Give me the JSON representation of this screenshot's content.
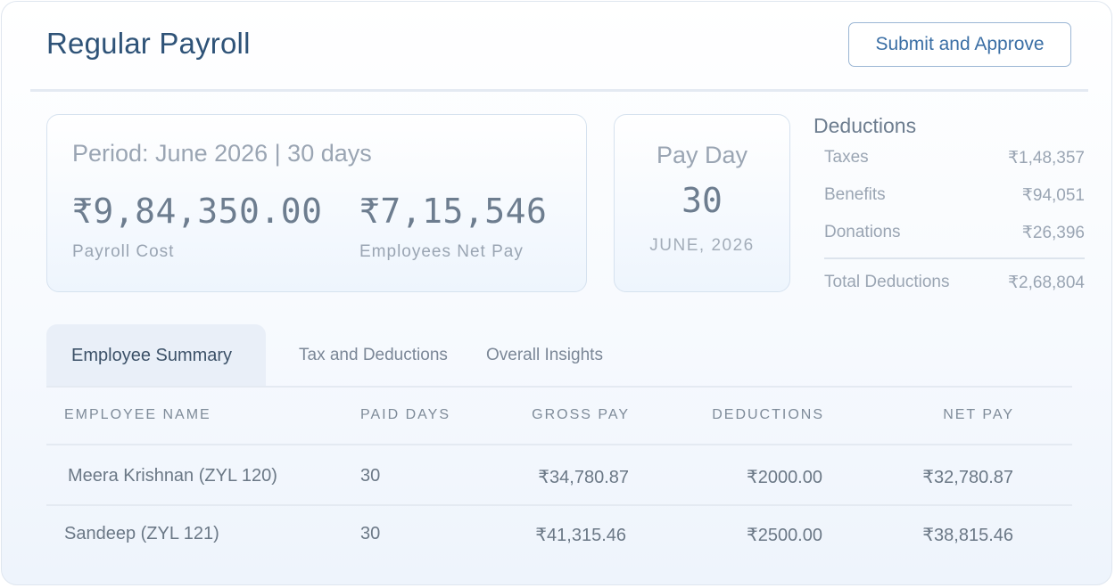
{
  "header": {
    "title": "Regular Payroll",
    "submit_label": "Submit and Approve"
  },
  "summary": {
    "period_text": "Period: June 2026 | 30 days",
    "payroll_cost_value": "₹9,84,350.00",
    "payroll_cost_label": "Payroll Cost",
    "net_pay_value": "₹7,15,546",
    "net_pay_label": "Employees Net Pay"
  },
  "payday": {
    "label": "Pay Day",
    "day": "30",
    "month": "JUNE, 2026"
  },
  "deductions": {
    "title": "Deductions",
    "items": [
      {
        "label": "Taxes",
        "value": "₹1,48,357"
      },
      {
        "label": "Benefits",
        "value": "₹94,051"
      },
      {
        "label": "Donations",
        "value": "₹26,396"
      }
    ],
    "total_label": "Total Deductions",
    "total_value": "₹2,68,804"
  },
  "tabs": [
    {
      "label": "Employee Summary",
      "active": true
    },
    {
      "label": "Tax and Deductions",
      "active": false
    },
    {
      "label": "Overall Insights",
      "active": false
    }
  ],
  "table": {
    "headers": [
      "EMPLOYEE NAME",
      "PAID DAYS",
      "GROSS PAY",
      "DEDUCTIONS",
      "NET PAY"
    ],
    "rows": [
      [
        "Meera Krishnan (ZYL 120)",
        "30",
        "₹34,780.87",
        "₹2000.00",
        "₹32,780.87"
      ],
      [
        "Sandeep (ZYL 121)",
        "30",
        "₹41,315.46",
        "₹2500.00",
        "₹38,815.46"
      ]
    ]
  },
  "colors": {
    "accent": "#3b6fa5",
    "title": "#2f5378",
    "active_tab_bg": "#e9eff8"
  }
}
